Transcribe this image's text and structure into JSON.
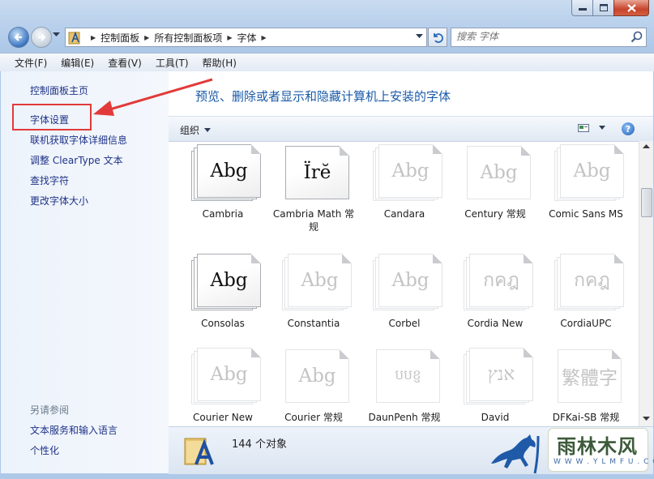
{
  "window": {
    "minimize_icon": "minimize-icon",
    "maximize_icon": "maximize-icon",
    "close_icon": "close-icon"
  },
  "address": {
    "crumbs": [
      "控制面板",
      "所有控制面板项",
      "字体"
    ],
    "search_placeholder": "搜索 字体"
  },
  "menu": [
    "文件(F)",
    "编辑(E)",
    "查看(V)",
    "工具(T)",
    "帮助(H)"
  ],
  "sidebar": {
    "tasks": [
      "控制面板主页",
      "字体设置",
      "联机获取字体详细信息",
      "调整 ClearType 文本",
      "查找字符",
      "更改字体大小"
    ],
    "see_also_title": "另请参阅",
    "see_also": [
      "文本服务和输入语言",
      "个性化"
    ]
  },
  "main": {
    "heading": "预览、删除或者显示和隐藏计算机上安装的字体",
    "organize_label": "组织"
  },
  "fonts": [
    {
      "name": "Cambria",
      "sample": "Abg",
      "stack": true,
      "faded": false
    },
    {
      "name": "Cambria Math 常规",
      "sample": "Ïrĕ",
      "stack": false,
      "faded": false
    },
    {
      "name": "Candara",
      "sample": "Abg",
      "stack": true,
      "faded": true
    },
    {
      "name": "Century 常规",
      "sample": "Abg",
      "stack": false,
      "faded": true
    },
    {
      "name": "Comic Sans MS",
      "sample": "Abg",
      "stack": true,
      "faded": true
    },
    {
      "name": "Consolas",
      "sample": "Abg",
      "stack": true,
      "faded": false
    },
    {
      "name": "Constantia",
      "sample": "Abg",
      "stack": true,
      "faded": true
    },
    {
      "name": "Corbel",
      "sample": "Abg",
      "stack": true,
      "faded": true
    },
    {
      "name": "Cordia New",
      "sample": "กคฎ",
      "stack": true,
      "faded": true
    },
    {
      "name": "CordiaUPC",
      "sample": "กคฎ",
      "stack": true,
      "faded": true
    },
    {
      "name": "Courier New",
      "sample": "Abg",
      "stack": true,
      "faded": true
    },
    {
      "name": "Courier 常规",
      "sample": "Abg",
      "stack": false,
      "faded": true
    },
    {
      "name": "DaunPenh 常规",
      "sample": "បបខ្ញ",
      "stack": false,
      "faded": true
    },
    {
      "name": "David",
      "sample": "אנץ",
      "stack": true,
      "faded": true
    },
    {
      "name": "DFKai-SB 常规",
      "sample": "繁體字",
      "stack": false,
      "faded": true
    }
  ],
  "status": {
    "count_text": "144 个对象"
  },
  "watermark": {
    "title": "雨林木风",
    "url": "W W W . Y L M F U . C O M"
  }
}
